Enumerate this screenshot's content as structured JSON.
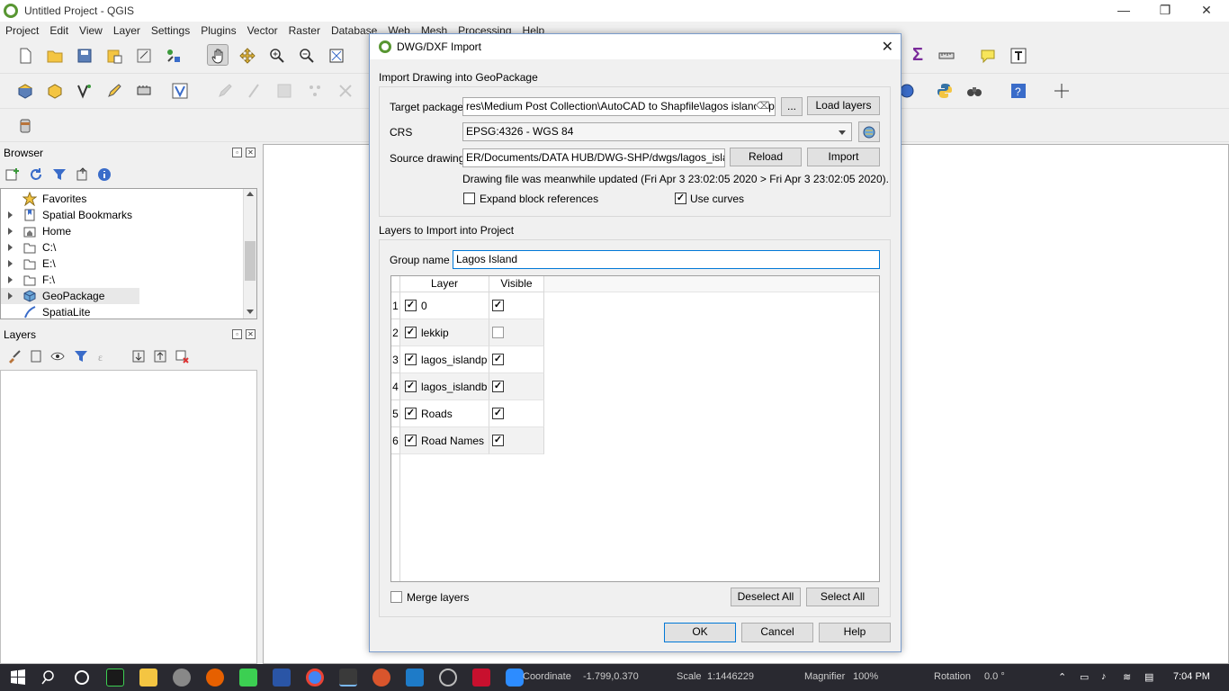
{
  "window": {
    "title": "Untitled Project - QGIS",
    "minimize": "—",
    "restore": "❐",
    "close": "✕"
  },
  "menu": [
    "Project",
    "Edit",
    "View",
    "Layer",
    "Settings",
    "Plugins",
    "Vector",
    "Raster",
    "Database",
    "Web",
    "Mesh",
    "Processing",
    "Help"
  ],
  "browser_panel": {
    "title": "Browser",
    "items": [
      {
        "label": "Favorites",
        "icon": "star-icon",
        "expandable": false
      },
      {
        "label": "Spatial Bookmarks",
        "icon": "bookmark-icon",
        "expandable": true
      },
      {
        "label": "Home",
        "icon": "home-folder-icon",
        "expandable": true
      },
      {
        "label": "C:\\",
        "icon": "folder-icon",
        "expandable": true
      },
      {
        "label": "E:\\",
        "icon": "folder-icon",
        "expandable": true
      },
      {
        "label": "F:\\",
        "icon": "folder-icon",
        "expandable": true
      },
      {
        "label": "GeoPackage",
        "icon": "geopackage-icon",
        "expandable": true
      },
      {
        "label": "SpatiaLite",
        "icon": "spatialite-icon",
        "expandable": false
      }
    ]
  },
  "layers_panel": {
    "title": "Layers"
  },
  "dialog": {
    "title": "DWG/DXF Import",
    "import_group_label": "Import Drawing into GeoPackage",
    "target_package_label": "Target package",
    "target_package_value": "res\\Medium Post Collection\\AutoCAD to Shapfile\\lagos island.gpkg",
    "browse_label": "...",
    "load_layers_label": "Load layers",
    "crs_label": "CRS",
    "crs_value": "EPSG:4326 - WGS 84",
    "source_drawing_label": "Source drawing",
    "source_drawing_value": "ER/Documents/DATA HUB/DWG-SHP/dwgs/lagos_island.dxf",
    "reload_label": "Reload",
    "import_label": "Import",
    "status_message": "Drawing file was meanwhile updated (Fri Apr 3 23:02:05 2020 > Fri Apr 3 23:02:05 2020).",
    "expand_block_label": "Expand block references",
    "expand_block_checked": false,
    "use_curves_label": "Use curves",
    "use_curves_checked": true,
    "layers_group_label": "Layers to Import into Project",
    "group_name_label": "Group name",
    "group_name_value": "Lagos Island",
    "table_headers": {
      "layer": "Layer",
      "visible": "Visible"
    },
    "rows": [
      {
        "num": "1",
        "name": "0",
        "import": true,
        "visible": true
      },
      {
        "num": "2",
        "name": "lekkip",
        "import": true,
        "visible": false
      },
      {
        "num": "3",
        "name": "lagos_islandp",
        "import": true,
        "visible": true
      },
      {
        "num": "4",
        "name": "lagos_islandb",
        "import": true,
        "visible": true
      },
      {
        "num": "5",
        "name": "Roads",
        "import": true,
        "visible": true
      },
      {
        "num": "6",
        "name": "Road Names",
        "import": true,
        "visible": true
      }
    ],
    "merge_layers_label": "Merge layers",
    "merge_layers_checked": false,
    "deselect_all_label": "Deselect All",
    "select_all_label": "Select All",
    "ok_label": "OK",
    "cancel_label": "Cancel",
    "help_label": "Help"
  },
  "statusbar": {
    "coordinate_label": "Coordinate",
    "coordinate_value": "-1.799,0.370",
    "scale_label": "Scale",
    "scale_value": "1:1446229",
    "magnifier_label": "Magnifier",
    "magnifier_value": "100%",
    "rotation_label": "Rotation",
    "rotation_value": "0.0 °"
  },
  "taskbar": {
    "time": "7:04 PM"
  },
  "colors": {
    "qgis_green": "#589632",
    "accent_blue": "#0078d7",
    "taskbar_bg": "#181820"
  }
}
